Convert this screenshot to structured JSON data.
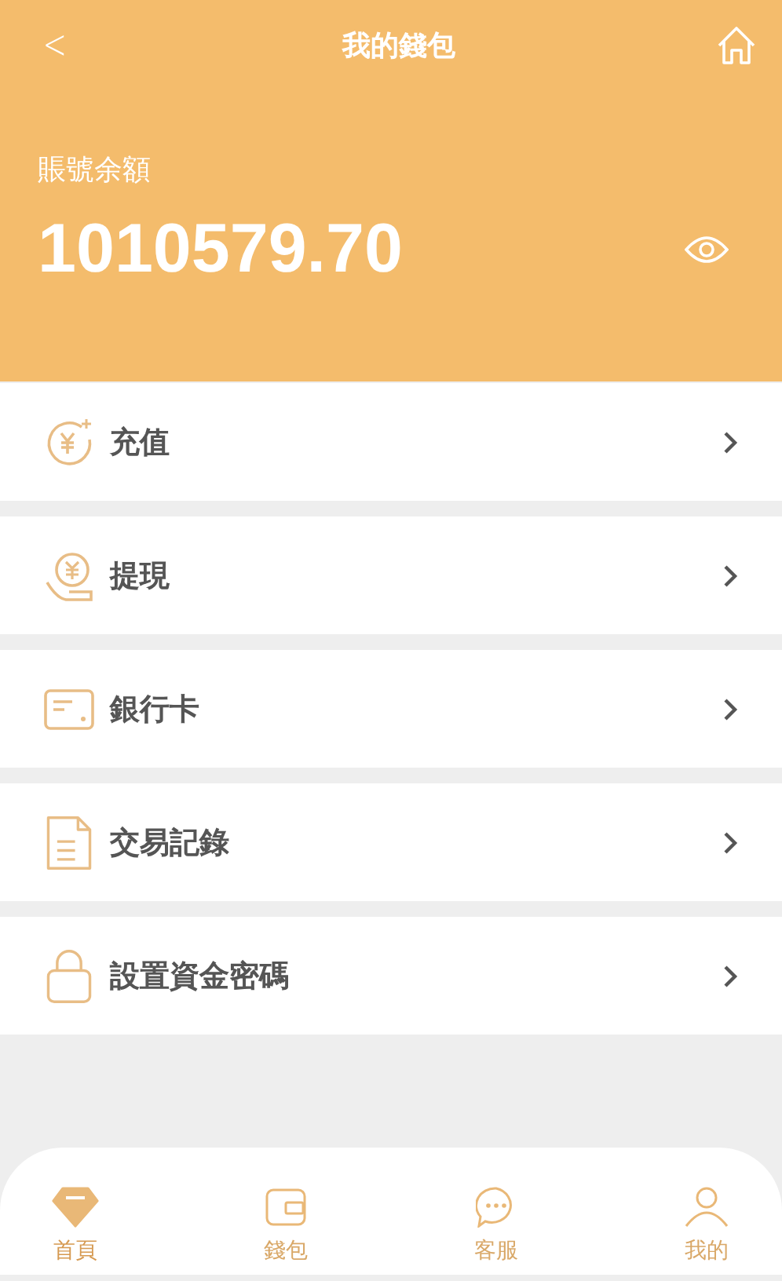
{
  "header": {
    "back": "<",
    "title": "我的錢包"
  },
  "balance": {
    "label": "賬號余額",
    "amount": "1010579.70",
    "visible": true
  },
  "menu": [
    {
      "kind": "recharge",
      "label": "充值"
    },
    {
      "kind": "withdraw",
      "label": "提現"
    },
    {
      "kind": "card",
      "label": "銀行卡"
    },
    {
      "kind": "records",
      "label": "交易記錄"
    },
    {
      "kind": "password",
      "label": "設置資金密碼"
    }
  ],
  "tabbar": [
    {
      "kind": "home",
      "label": "首頁",
      "selected": true
    },
    {
      "kind": "wallet",
      "label": "錢包",
      "selected": false
    },
    {
      "kind": "service",
      "label": "客服",
      "selected": false
    },
    {
      "kind": "me",
      "label": "我的",
      "selected": false
    }
  ]
}
